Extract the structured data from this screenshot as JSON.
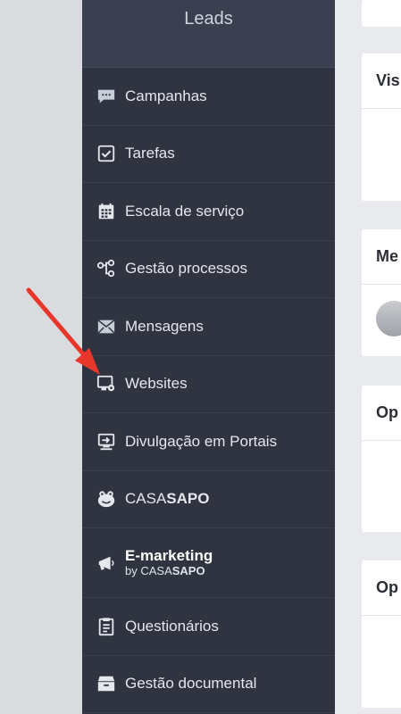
{
  "sidebar": {
    "header_title": "Leads",
    "items": [
      {
        "label": "Campanhas",
        "icon": "chat-bubble-icon"
      },
      {
        "label": "Tarefas",
        "icon": "checkbox-icon"
      },
      {
        "label": "Escala de serviço",
        "icon": "calendar-icon"
      },
      {
        "label": "Gestão processos",
        "icon": "workflow-icon"
      },
      {
        "label": "Mensagens",
        "icon": "envelope-icon"
      },
      {
        "label": "Websites",
        "icon": "monitor-gear-icon"
      },
      {
        "label": "Divulgação em Portais",
        "icon": "monitor-share-icon"
      },
      {
        "label_prefix": "CASA",
        "label_bold": "SAPO",
        "icon": "casasapo-frog-icon"
      },
      {
        "label": "E-marketing",
        "sub_prefix": "by CASA",
        "sub_bold": "SAPO",
        "icon": "megaphone-icon"
      },
      {
        "label": "Questionários",
        "icon": "clipboard-icon"
      },
      {
        "label": "Gestão documental",
        "icon": "archive-box-icon"
      }
    ]
  },
  "content": {
    "cards": [
      {
        "title": ""
      },
      {
        "title": "Vis"
      },
      {
        "title": "Me"
      },
      {
        "title": "Op"
      },
      {
        "title": "Op"
      }
    ]
  },
  "annotation": {
    "color": "#e8362b"
  },
  "colors": {
    "sidebar_bg": "#2f3440",
    "sidebar_header_bg": "#3a4050",
    "page_bg": "#e9eaed"
  }
}
